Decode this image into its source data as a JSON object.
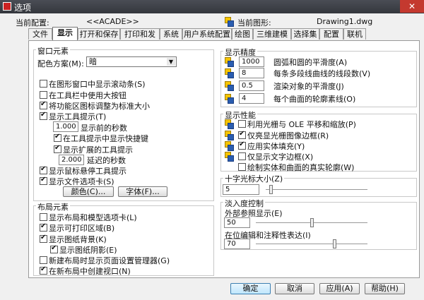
{
  "window": {
    "title": "选项",
    "close_glyph": "✕"
  },
  "profile": {
    "current_config_label": "当前配置:",
    "current_config_value": "<<ACADE>>",
    "current_drawing_label": "当前图形:",
    "current_drawing_value": "Drawing1.dwg"
  },
  "tabs": [
    "文件",
    "显示",
    "打开和保存",
    "打印和发布",
    "系统",
    "用户系统配置",
    "绘图",
    "三维建模",
    "选择集",
    "配置",
    "联机"
  ],
  "window_elements": {
    "title": "窗口元素",
    "color_scheme_label": "配色方案(M):",
    "color_scheme_value": "暗",
    "checkboxes": [
      {
        "label": "在图形窗口中显示滚动条(S)",
        "checked": false
      },
      {
        "label": "在工具栏中使用大按钮",
        "checked": false
      },
      {
        "label": "将功能区图标调整为标准大小",
        "checked": true
      },
      {
        "label": "显示工具提示(T)",
        "checked": true
      }
    ],
    "delay_seconds": "1.000",
    "delay_label": "显示前的秒数",
    "sub_checkboxes": [
      {
        "label": "在工具提示中显示快捷键",
        "checked": true
      },
      {
        "label": "显示扩展的工具提示",
        "checked": true
      }
    ],
    "ext_delay_seconds": "2.000",
    "ext_delay_label": "延迟的秒数",
    "checkboxes2": [
      {
        "label": "显示鼠标悬停工具提示",
        "checked": true
      },
      {
        "label": "显示文件选项卡(S)",
        "checked": true
      }
    ],
    "color_button": "颜色(C)...",
    "font_button": "字体(F)..."
  },
  "layout_elements": {
    "title": "布局元素",
    "checkboxes": [
      {
        "label": "显示布局和模型选项卡(L)",
        "checked": false
      },
      {
        "label": "显示可打印区域(B)",
        "checked": true
      },
      {
        "label": "显示图纸背景(K)",
        "checked": true
      }
    ],
    "shadow": {
      "label": "显示图纸阴影(E)",
      "checked": true
    },
    "checkboxes2": [
      {
        "label": "新建布局时显示页面设置管理器(G)",
        "checked": false
      },
      {
        "label": "在新布局中创建视口(N)",
        "checked": true
      }
    ]
  },
  "display_resolution": {
    "title": "显示精度",
    "items": [
      {
        "value": "1000",
        "label": "圆弧和圆的平滑度(A)"
      },
      {
        "value": "8",
        "label": "每条多段线曲线的线段数(V)"
      },
      {
        "value": "0.5",
        "label": "渲染对象的平滑度(J)"
      },
      {
        "value": "4",
        "label": "每个曲面的轮廓素线(O)"
      }
    ]
  },
  "display_performance": {
    "title": "显示性能",
    "items": [
      {
        "label": "利用光栅与 OLE 平移和缩放(P)",
        "checked": false,
        "icon": true
      },
      {
        "label": "仅亮显光栅图像边框(R)",
        "checked": true,
        "icon": true
      },
      {
        "label": "应用实体填充(Y)",
        "checked": true,
        "icon": true
      },
      {
        "label": "仅显示文字边框(X)",
        "checked": false,
        "icon": true
      },
      {
        "label": "绘制实体和曲面的真实轮廓(W)",
        "checked": false,
        "icon": false
      }
    ]
  },
  "crosshair": {
    "title": "十字光标大小(Z)",
    "value": "5",
    "slider_pct": 5
  },
  "fade": {
    "title": "淡入度控制",
    "xref_label": "外部参照显示(E)",
    "xref_value": "50",
    "xref_pct": 50,
    "inplace_label": "在位编辑和注释性表达(I)",
    "inplace_value": "70",
    "inplace_pct": 70
  },
  "buttons": {
    "ok": "确定",
    "cancel": "取消",
    "apply": "应用(A)",
    "help": "帮助(H)"
  }
}
